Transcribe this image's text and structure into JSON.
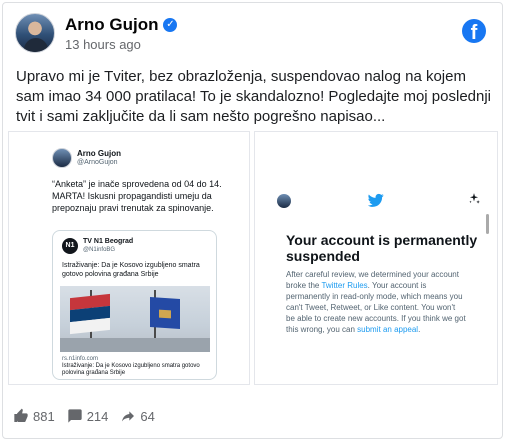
{
  "post": {
    "author": "Arno Gujon",
    "time": "13 hours ago",
    "text": "Upravo mi je Tviter, bez obrazloženja, suspendovao nalog na kojem sam imao 34 000 pratilaca! To je skandalozno! Pogledajte moj poslednji tvit i sami zaključite da li sam nešto pogrešno napisao..."
  },
  "tweet": {
    "author": "Arno Gujon",
    "handle": "@ArnoGujon",
    "text": "“Anketa” je inače sprovedena od 04 do 14. MARTA! Iskusni propagandisti umeju da prepoznaju pravi trenutak za spinovanje.",
    "quote": {
      "author": "TV N1 Beograd",
      "handle": "@N1infoBG",
      "logo": "N1",
      "text": "Istraživanje: Da je Kosovo izgubljeno smatra gotovo polovina građana Srbije",
      "source": "rs.n1info.com",
      "caption": "Istraživanje: Da je Kosovo izgubljeno smatra gotovo polovina građana Srbije"
    }
  },
  "suspended": {
    "title": "Your account is permanently suspended",
    "body_start": "After careful review, we determined your account broke the ",
    "rules_link": "Twitter Rules",
    "body_mid": ". Your account is permanently in read-only mode, which means you can't Tweet, Retweet, or Like content. You won't be able to create new accounts. If you think we got this wrong, you can ",
    "appeal_link": "submit an appeal",
    "body_end": "."
  },
  "reactions": {
    "likes": "881",
    "comments": "214",
    "shares": "64"
  },
  "colors": {
    "facebook_blue": "#1877f2",
    "twitter_blue": "#1d9bf0"
  }
}
